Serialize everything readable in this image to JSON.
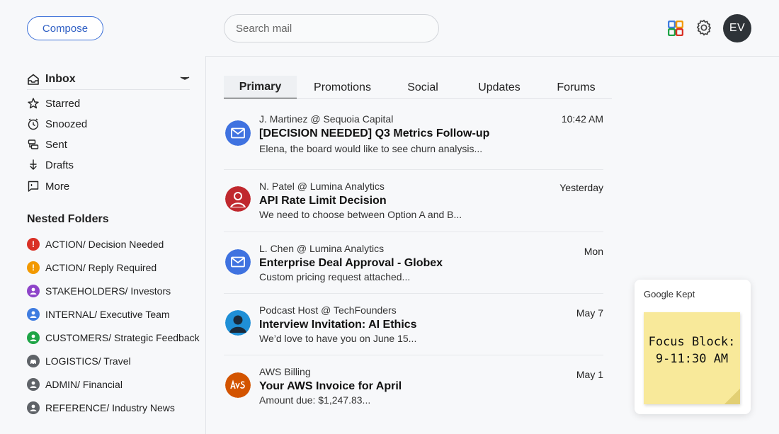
{
  "header": {
    "compose_label": "Compose",
    "search_placeholder": "Search mail",
    "avatar_initials": "EV"
  },
  "sidebar": {
    "inbox_label": "Inbox",
    "items": [
      {
        "label": "Starred",
        "icon": "star-icon"
      },
      {
        "label": "Snoozed",
        "icon": "clock-icon"
      },
      {
        "label": "Sent",
        "icon": "send-icon"
      },
      {
        "label": "Drafts",
        "icon": "draft-icon"
      },
      {
        "label": "More",
        "icon": "more-icon"
      }
    ],
    "nested_title": "Nested Folders",
    "folders": [
      {
        "category": "ACTION",
        "name": " / Decision Needed",
        "color": "#d93025",
        "icon": "alert-icon"
      },
      {
        "category": "ACTION",
        "name": " / Reply Required",
        "color": "#f29900",
        "icon": "alert-icon"
      },
      {
        "category": "STAKEHOLDERS",
        "name": " / Investors",
        "color": "#8e44c9",
        "icon": "person-icon"
      },
      {
        "category": "INTERNAL",
        "name": " / Executive Team",
        "color": "#3f7ce0",
        "icon": "person-icon"
      },
      {
        "category": "CUSTOMERS",
        "name": " / Strategic Feedback",
        "color": "#1ea446",
        "icon": "person-icon"
      },
      {
        "category": "LOGISTICS",
        "name": " / Travel",
        "color": "#5f6368",
        "icon": "car-icon"
      },
      {
        "category": "ADMIN",
        "name": " / Financial",
        "color": "#5f6368",
        "icon": "person-icon"
      },
      {
        "category": "REFERENCE",
        "name": " / Industry News",
        "color": "#5f6368",
        "icon": "person-icon"
      }
    ]
  },
  "tabs": [
    {
      "label": "Primary",
      "active": true
    },
    {
      "label": "Promotions",
      "active": false
    },
    {
      "label": "Social",
      "active": false
    },
    {
      "label": "Updates",
      "active": false
    },
    {
      "label": "Forums",
      "active": false
    }
  ],
  "emails": [
    {
      "sender": "J. Martinez @ Sequoia Capital",
      "subject": "[DECISION NEEDED] Q3 Metrics Follow-up",
      "snippet": "Elena, the board would like to see churn analysis...",
      "time": "10:42 AM",
      "icon": "envelope-icon"
    },
    {
      "sender": "N. Patel @ Lumina Analytics",
      "subject": "API Rate Limit Decision",
      "snippet": "We need to choose between Option A and B...",
      "time": "Yesterday",
      "icon": "person-avatar-icon"
    },
    {
      "sender": "L. Chen @ Lumina Analytics",
      "subject": "Enterprise Deal Approval - Globex",
      "snippet": "Custom pricing request attached...",
      "time": "Mon",
      "icon": "envelope-icon"
    },
    {
      "sender": "Podcast Host @ TechFounders",
      "subject": "Interview Invitation: AI Ethics",
      "snippet": "We’d love to have you on June 15...",
      "time": "May 7",
      "icon": "person-avatar-icon"
    },
    {
      "sender": "AWS Billing",
      "subject": "Your AWS Invoice for April",
      "snippet": "Amount due: $1,247.83...",
      "time": "May 1",
      "icon": "aws-logo-icon"
    }
  ],
  "kept": {
    "title": "Google Kept",
    "note_line1": "Focus Block:",
    "note_line2": "9-11:30 AM"
  },
  "colors": {
    "accent": "#3b6fd8",
    "envelope_blue": "#3f72e0",
    "person_red": "#c0282e",
    "podcast_blue": "#1f8fd6",
    "aws_orange": "#d35400",
    "note_yellow": "#f8e99a"
  }
}
